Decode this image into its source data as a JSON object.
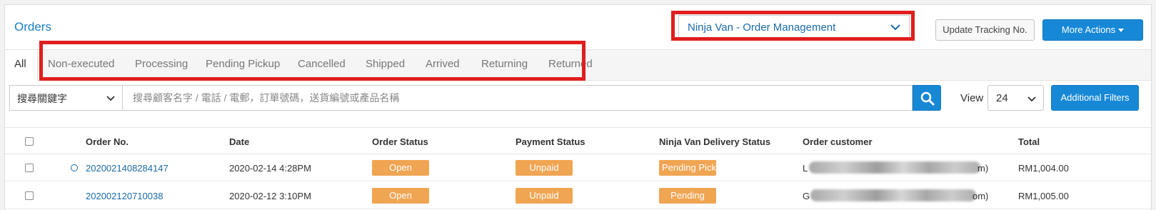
{
  "header": {
    "title": "Orders",
    "channel_select_value": "Ninja Van - Order Management",
    "update_tracking_label": "Update Tracking No.",
    "more_actions_label": "More Actions"
  },
  "tabs": [
    {
      "label": "All",
      "active": true
    },
    {
      "label": "Non-executed"
    },
    {
      "label": "Processing"
    },
    {
      "label": "Pending Pickup"
    },
    {
      "label": "Cancelled"
    },
    {
      "label": "Shipped"
    },
    {
      "label": "Arrived"
    },
    {
      "label": "Returning"
    },
    {
      "label": "Returned"
    }
  ],
  "search": {
    "keyword_select_value": "搜尋關鍵字",
    "placeholder": "搜尋顧客名字 / 電話 / 電郵，訂單號碼，送貨編號或產品名稱",
    "view_label": "View",
    "view_value": "24",
    "additional_filters_label": "Additional Filters"
  },
  "table": {
    "columns": [
      "Order No.",
      "Date",
      "Order Status",
      "Payment Status",
      "Ninja Van Delivery Status",
      "Order customer",
      "Total"
    ],
    "rows": [
      {
        "order_no": "2020021408284147",
        "date": "2020-02-14 4:28PM",
        "order_status": "Open",
        "payment_status": "Unpaid",
        "delivery_status": "Pending Pickup",
        "customer_prefix": "L",
        "customer_suffix": "m)",
        "total": "RM1,004.00",
        "indicator": true
      },
      {
        "order_no": "202002120710038",
        "date": "2020-02-12 3:10PM",
        "order_status": "Open",
        "payment_status": "Unpaid",
        "delivery_status": "Pending",
        "customer_prefix": "G",
        "customer_suffix": "om)",
        "total": "RM1,005.00",
        "indicator": false
      }
    ]
  },
  "colors": {
    "accent_blue": "#1788d6",
    "link_blue": "#1a6aa8",
    "badge_orange": "#f0a553",
    "highlight_red": "#e01e1e"
  }
}
